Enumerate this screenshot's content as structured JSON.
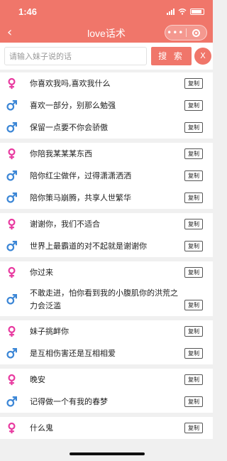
{
  "status": {
    "time": "1:46"
  },
  "nav": {
    "back": "‹",
    "title": "love话术",
    "more": "•••"
  },
  "search": {
    "placeholder": "请输入妹子说的话",
    "value": "",
    "button": "搜 索",
    "clear": "X"
  },
  "copy_label": "复制",
  "colors": {
    "accent": "#f0766a",
    "female": "#e83aa0",
    "male": "#3b86d6"
  },
  "groups": [
    {
      "rows": [
        {
          "gender": "female",
          "text": "你喜欢我吗,喜欢我什么"
        },
        {
          "gender": "male",
          "text": "喜欢一部分，别那么勉强"
        },
        {
          "gender": "male",
          "text": "保留一点要不你会骄傲"
        }
      ]
    },
    {
      "rows": [
        {
          "gender": "female",
          "text": "你陪我某某某东西"
        },
        {
          "gender": "male",
          "text": "陪你红尘做伴，过得潇潇洒洒"
        },
        {
          "gender": "male",
          "text": "陪你策马崩腾，共享人世繁华"
        }
      ]
    },
    {
      "rows": [
        {
          "gender": "female",
          "text": "谢谢你，我们不适合"
        },
        {
          "gender": "male",
          "text": "世界上最霸道的对不起就是谢谢你"
        }
      ]
    },
    {
      "rows": [
        {
          "gender": "female",
          "text": "你过来"
        },
        {
          "gender": "male",
          "text": "不敢走进，怕你看到我的小腹肌你的洪荒之力会泛滥",
          "tall": true
        }
      ]
    },
    {
      "rows": [
        {
          "gender": "female",
          "text": "妹子挑衅你"
        },
        {
          "gender": "male",
          "text": "是互相伤害还是互相相爱"
        }
      ]
    },
    {
      "rows": [
        {
          "gender": "female",
          "text": "晚安"
        },
        {
          "gender": "male",
          "text": "记得做一个有我的春梦"
        }
      ]
    },
    {
      "rows": [
        {
          "gender": "female",
          "text": "什么鬼"
        }
      ]
    }
  ]
}
